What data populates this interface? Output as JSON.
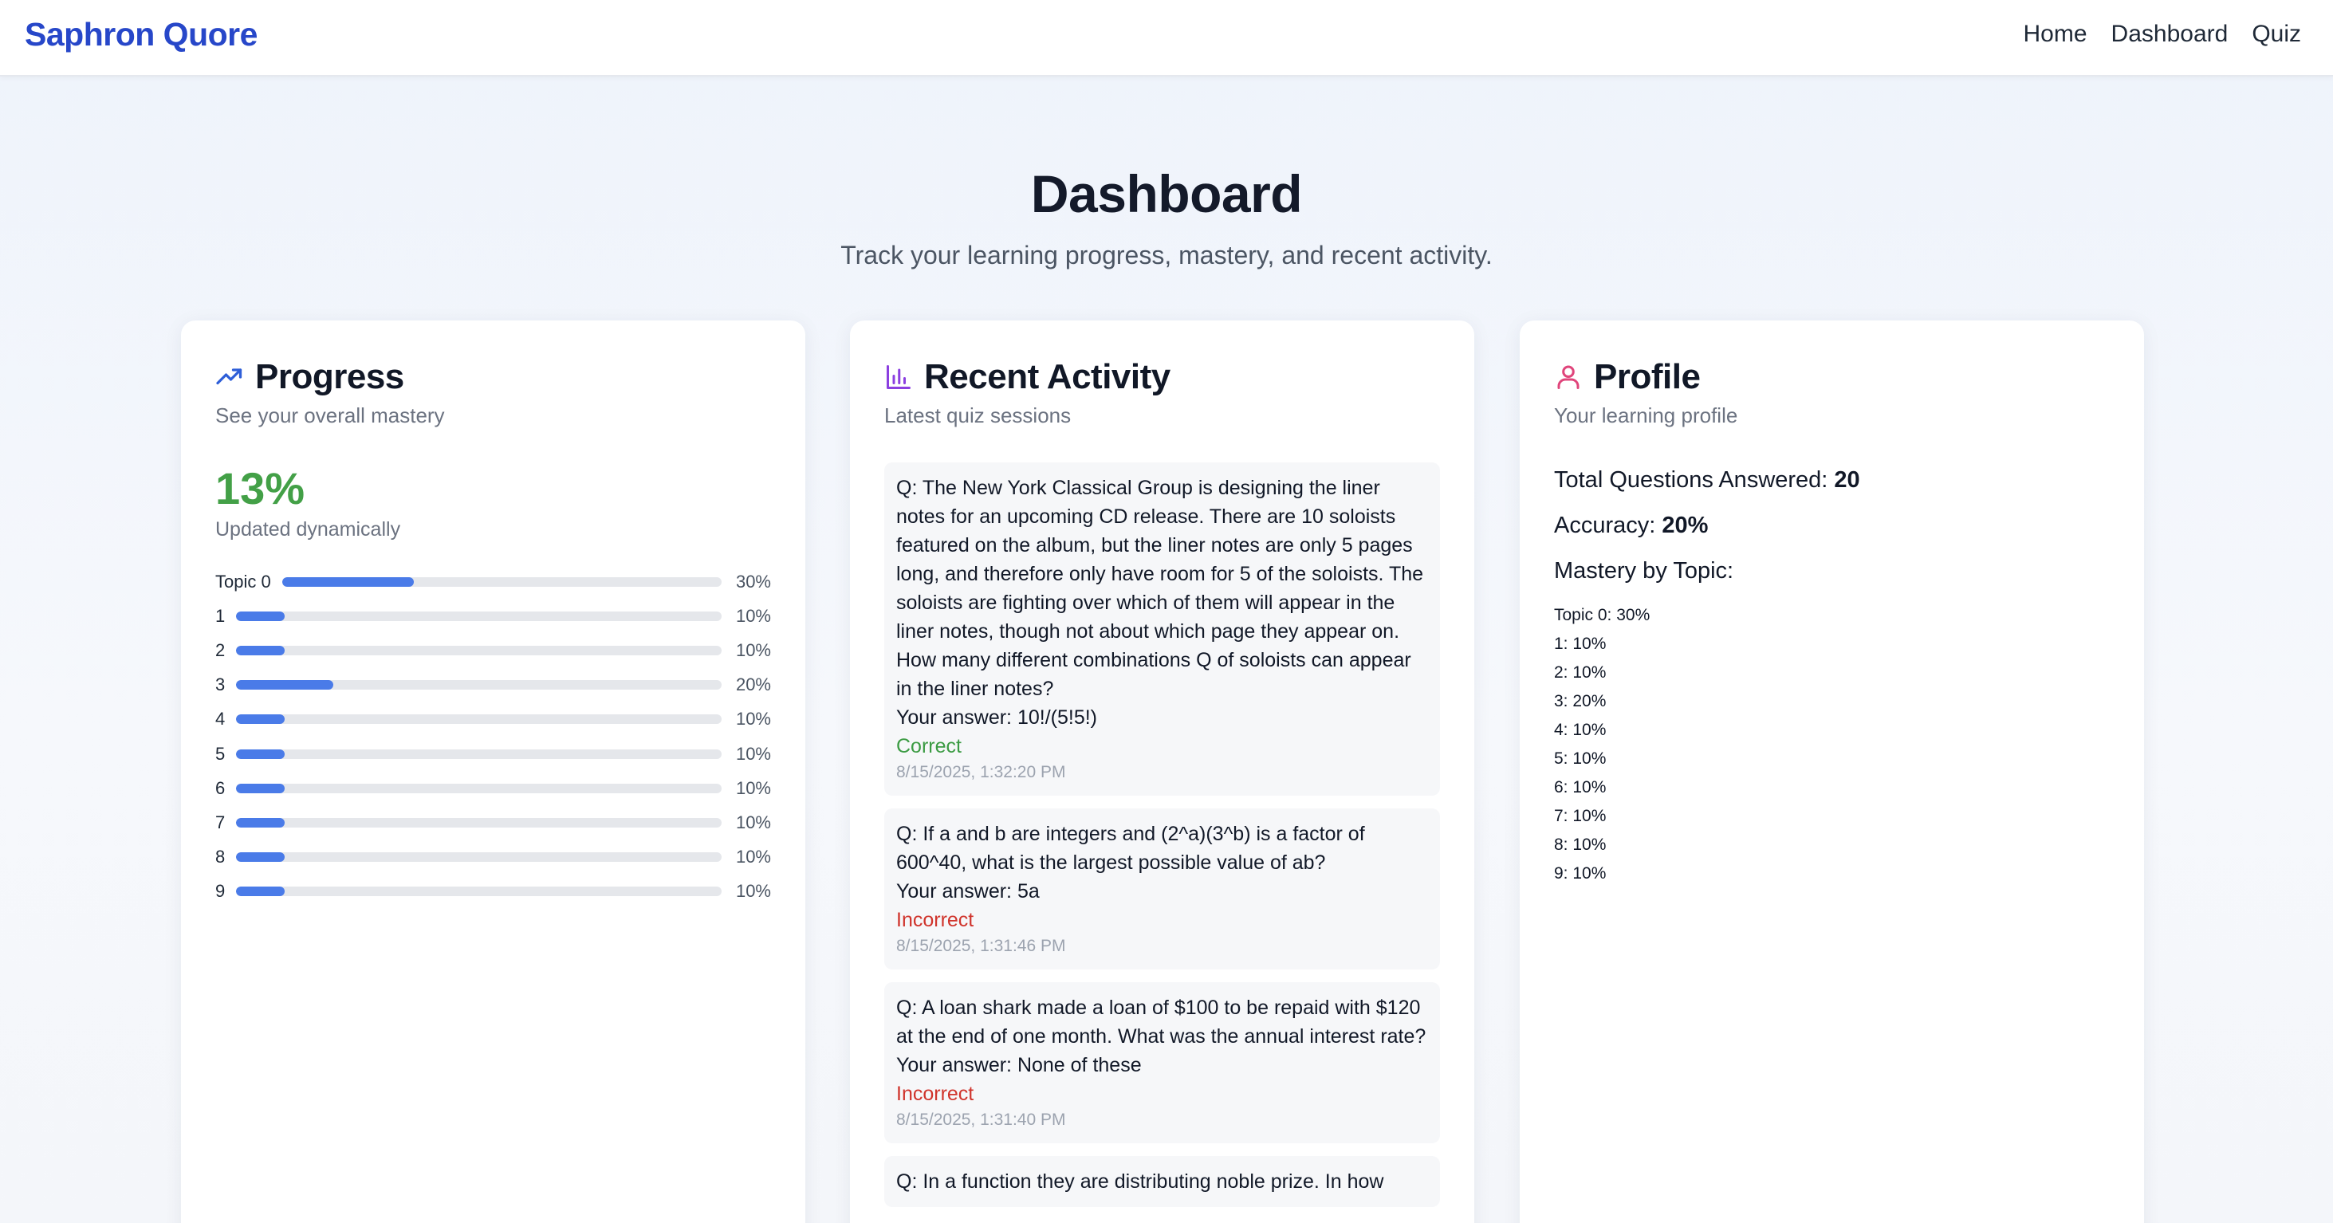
{
  "navbar": {
    "brand": "Saphron Quore",
    "links": [
      "Home",
      "Dashboard",
      "Quiz"
    ]
  },
  "page": {
    "title": "Dashboard",
    "subtitle": "Track your learning progress, mastery, and recent activity."
  },
  "progress": {
    "icon": "trending-up-icon",
    "title": "Progress",
    "subtitle": "See your overall mastery",
    "mastery": "13%",
    "mastery_note": "Updated dynamically",
    "topics": [
      {
        "label": "Topic 0",
        "pct": "30%",
        "value": 0.3
      },
      {
        "label": "1",
        "pct": "10%",
        "value": 0.1
      },
      {
        "label": "2",
        "pct": "10%",
        "value": 0.1
      },
      {
        "label": "3",
        "pct": "20%",
        "value": 0.2
      },
      {
        "label": "4",
        "pct": "10%",
        "value": 0.1
      },
      {
        "label": "5",
        "pct": "10%",
        "value": 0.1
      },
      {
        "label": "6",
        "pct": "10%",
        "value": 0.1
      },
      {
        "label": "7",
        "pct": "10%",
        "value": 0.1
      },
      {
        "label": "8",
        "pct": "10%",
        "value": 0.1
      },
      {
        "label": "9",
        "pct": "10%",
        "value": 0.1
      }
    ]
  },
  "activity": {
    "icon": "bar-chart-icon",
    "title": "Recent Activity",
    "subtitle": "Latest quiz sessions",
    "items": [
      {
        "question": "Q: The New York Classical Group is designing the liner notes for an upcoming CD release. There are 10 soloists featured on the album, but the liner notes are only 5 pages long, and therefore only have room for 5 of the soloists. The soloists are fighting over which of them will appear in the liner notes, though not about which page they appear on. How many different combinations Q of soloists can appear in the liner notes?",
        "answer": "Your answer: 10!/(5!5!)",
        "status": "Correct",
        "correct": true,
        "time": "8/15/2025, 1:32:20 PM"
      },
      {
        "question": "Q: If a and b are integers and (2^a)(3^b) is a factor of 600^40, what is the largest possible value of ab?",
        "answer": "Your answer: 5a",
        "status": "Incorrect",
        "correct": false,
        "time": "8/15/2025, 1:31:46 PM"
      },
      {
        "question": "Q: A loan shark made a loan of $100 to be repaid with $120 at the end of one month. What was the annual interest rate?",
        "answer": "Your answer: None of these",
        "status": "Incorrect",
        "correct": false,
        "time": "8/15/2025, 1:31:40 PM"
      },
      {
        "question": "Q: In a function they are distributing noble prize. In how",
        "answer": "",
        "status": "",
        "correct": false,
        "time": ""
      }
    ]
  },
  "profile": {
    "icon": "user-icon",
    "title": "Profile",
    "subtitle": "Your learning profile",
    "total_label": "Total Questions Answered: ",
    "total_value": "20",
    "accuracy_label": "Accuracy: ",
    "accuracy_value": "20%",
    "mastery_heading": "Mastery by Topic:",
    "topics": [
      "Topic 0: 30%",
      "1: 10%",
      "2: 10%",
      "3: 20%",
      "4: 10%",
      "5: 10%",
      "6: 10%",
      "7: 10%",
      "8: 10%",
      "9: 10%"
    ]
  },
  "colors": {
    "brand": "#2747c9",
    "progress_icon": "#2f5fd8",
    "activity_icon": "#8b3fe0",
    "profile_icon": "#e0457b",
    "bar_fill": "#4a7be8",
    "correct": "#3b9b43",
    "incorrect": "#d0342c",
    "mastery": "#43a047"
  }
}
